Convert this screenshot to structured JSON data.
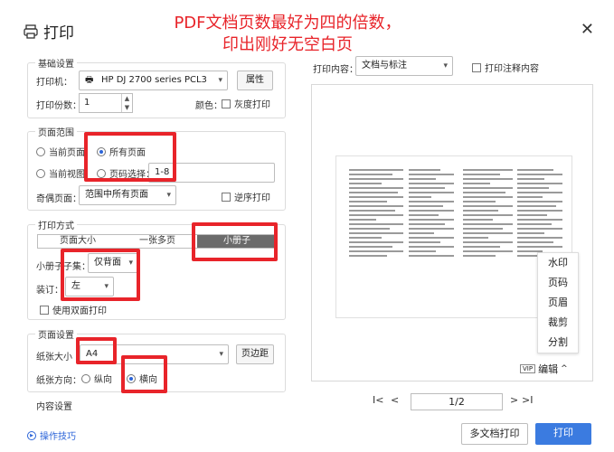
{
  "dialog": {
    "title": "打印",
    "close_symbol": "✕"
  },
  "annotation": {
    "line1": "PDF文档页数最好为四的倍数，",
    "line2": "印出刚好无空白页"
  },
  "basic": {
    "group_title": "基础设置",
    "printer_label": "打印机：",
    "printer_value": "HP DJ 2700 series PCL3",
    "properties_button": "属性",
    "copies_label": "打印份数：",
    "copies_value": "1",
    "color_label": "颜色：",
    "grayscale_label": "灰度打印"
  },
  "range": {
    "group_title": "页面范围",
    "current_page": "当前页面",
    "all_pages": "所有页面",
    "current_view": "当前视图",
    "page_select": "页码选择：",
    "page_select_value": "1-8",
    "odd_even_label": "奇偶页面：",
    "odd_even_value": "范围中所有页面",
    "reverse_label": "逆序打印"
  },
  "mode": {
    "group_title": "打印方式",
    "tabs": [
      "页面大小",
      "一张多页",
      "小册子"
    ],
    "booklet_label": "小册子子集：",
    "booklet_value": "仅背面",
    "binding_label": "装订：",
    "binding_value": "左",
    "duplex_label": "使用双面打印"
  },
  "page_setup": {
    "group_title": "页面设置",
    "paper_size_label": "纸张大小",
    "paper_size_value": "A4",
    "margin_button": "页边距",
    "orientation_label": "纸张方向：",
    "portrait": "纵向",
    "landscape": "横向"
  },
  "content_settings_label": "内容设置",
  "tips_label": "操作技巧",
  "print_content": {
    "label": "打印内容：",
    "value": "文档与标注",
    "annotations_label": "打印注释内容"
  },
  "edit_menu": {
    "items": [
      "水印",
      "页码",
      "页眉",
      "裁剪",
      "分割"
    ],
    "vip_tag": "VIP",
    "edit_label": "编辑"
  },
  "pager": {
    "value": "1/2",
    "first": "I<",
    "prev": "<",
    "next": ">",
    "last": ">I"
  },
  "footer": {
    "multi_doc": "多文档打印",
    "print": "打印"
  },
  "colors": {
    "accent": "#2b64d8",
    "highlight_red": "#e8242a",
    "print_button": "#3b7be0"
  }
}
